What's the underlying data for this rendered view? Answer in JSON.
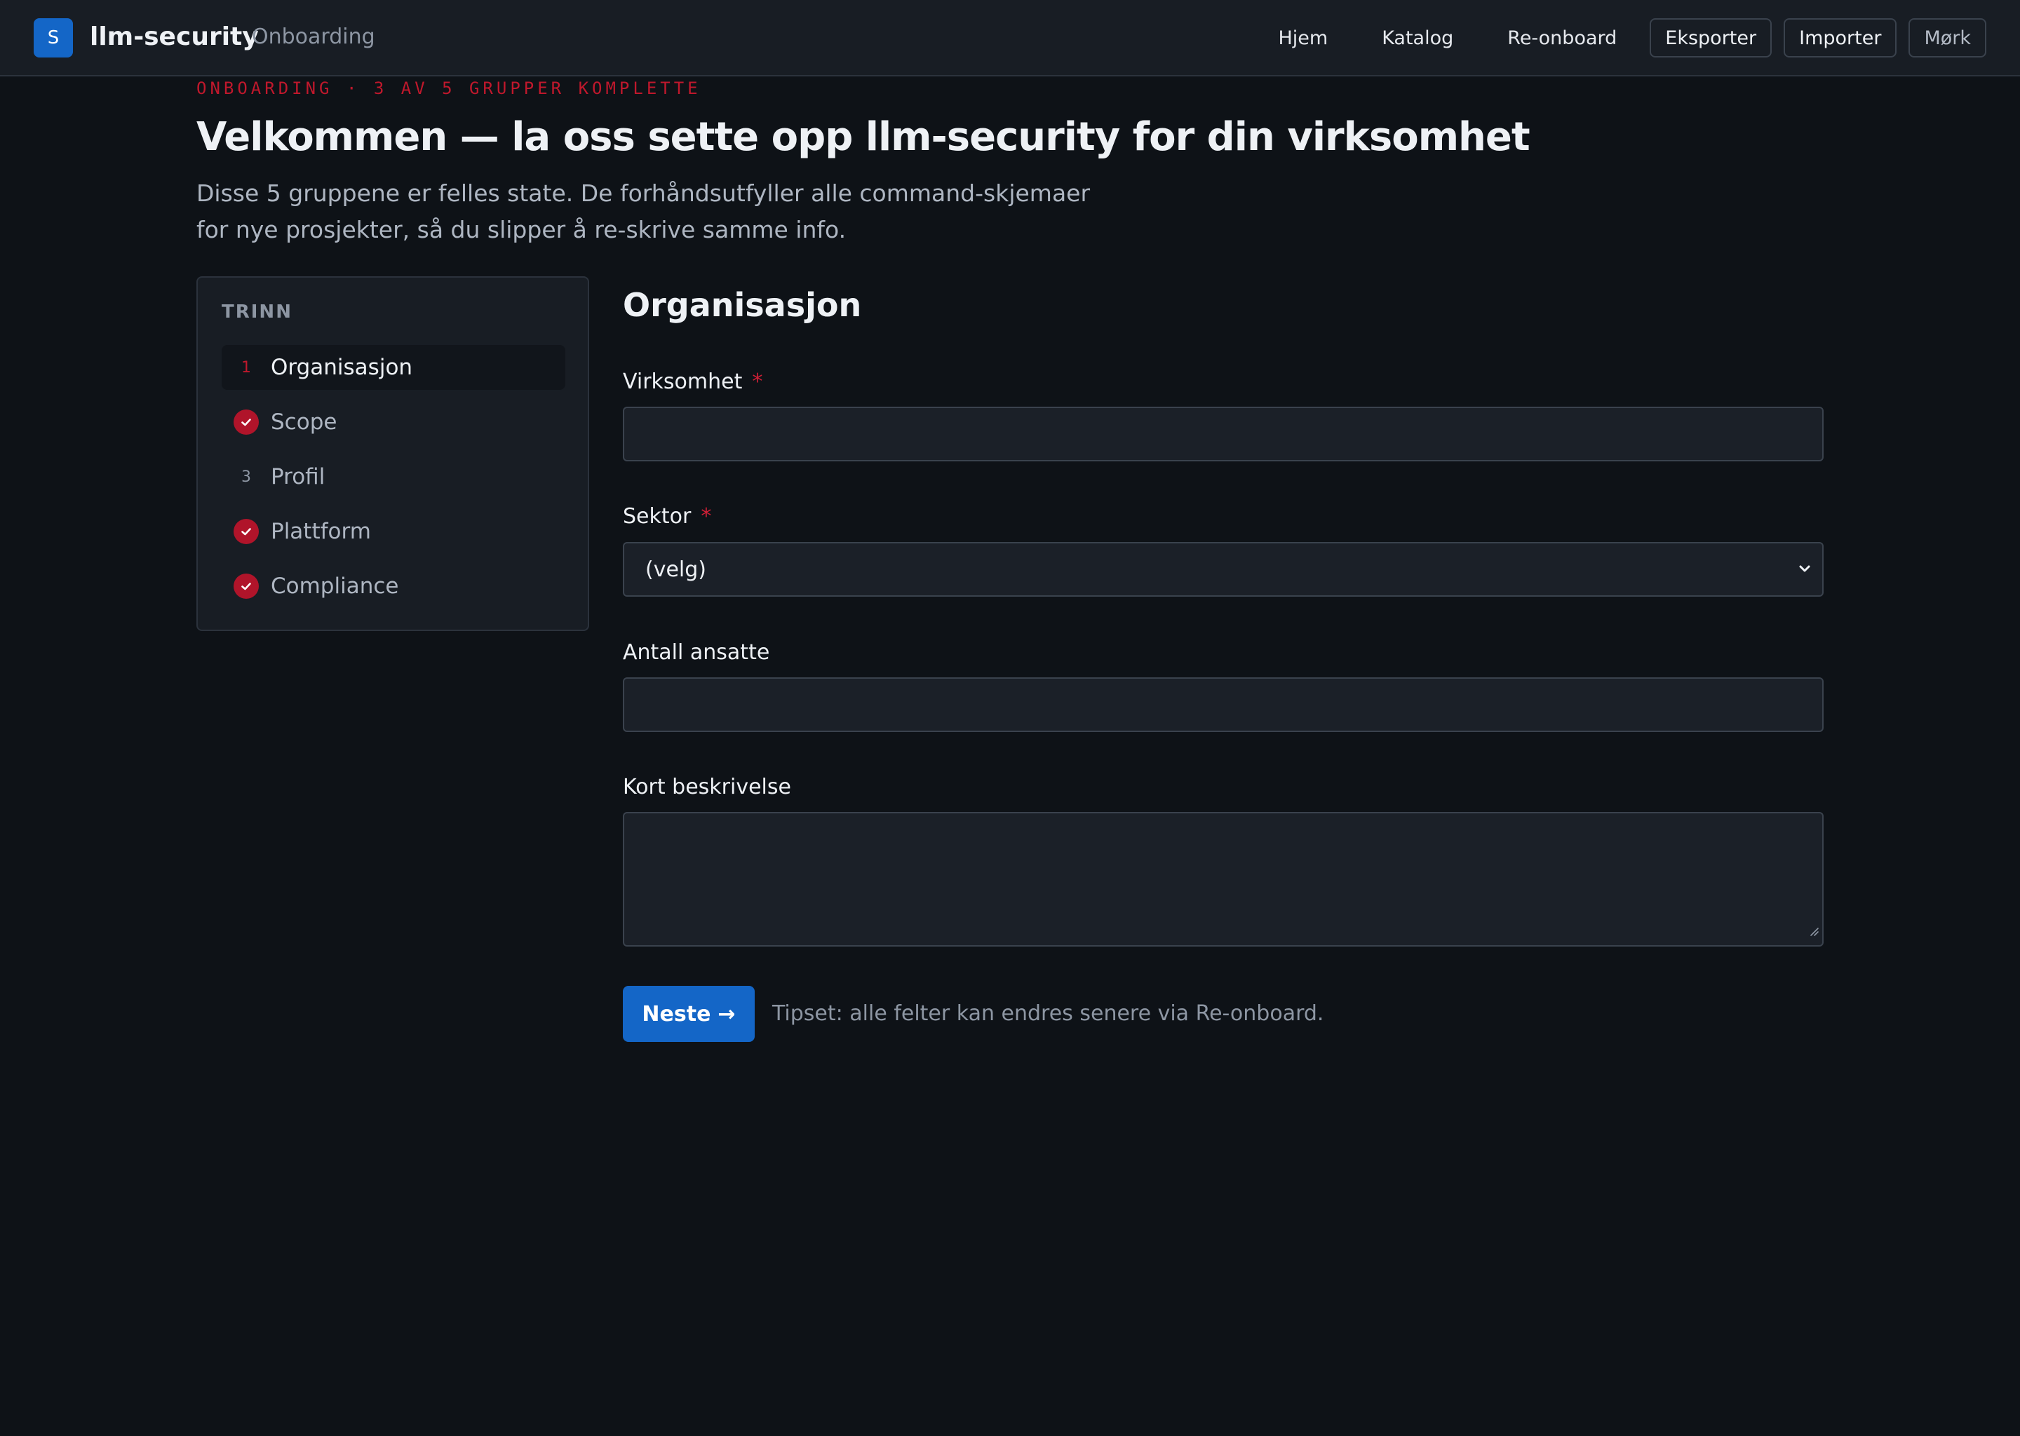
{
  "app": {
    "logo_letter": "S",
    "name": "llm-security",
    "section": "Onboarding"
  },
  "nav": {
    "links": [
      "Hjem",
      "Katalog",
      "Re-onboard"
    ],
    "buttons": [
      "Eksporter",
      "Importer",
      "Mørk"
    ]
  },
  "header": {
    "eyebrow": "ONBOARDING · 3 AV 5 GRUPPER KOMPLETTE",
    "title": "Velkommen — la oss sette opp llm-security for din virksomhet",
    "intro_line1": "Disse 5 gruppene er felles state. De forhåndsutfyller alle command-skjemaer",
    "intro_line2": "for nye prosjekter, så du slipper å re-skrive samme info."
  },
  "stepper": {
    "heading": "TRINN",
    "steps": [
      {
        "marker": "1",
        "label": "Organisasjon",
        "state": "active",
        "icon": "step-number"
      },
      {
        "marker": "",
        "label": "Scope",
        "state": "complete",
        "icon": "check-icon"
      },
      {
        "marker": "3",
        "label": "Profil",
        "state": "pending",
        "icon": "step-number"
      },
      {
        "marker": "",
        "label": "Plattform",
        "state": "complete",
        "icon": "check-icon"
      },
      {
        "marker": "",
        "label": "Compliance",
        "state": "complete",
        "icon": "check-icon"
      }
    ]
  },
  "form": {
    "title": "Organisasjon",
    "fields": {
      "virksomhet": {
        "label": "Virksomhet",
        "required_mark": "*",
        "value": ""
      },
      "sektor": {
        "label": "Sektor",
        "required_mark": "*",
        "value": "(velg)"
      },
      "ansatte": {
        "label": "Antall ansatte",
        "value": ""
      },
      "beskrivelse": {
        "label": "Kort beskrivelse",
        "value": ""
      }
    },
    "next_label": "Neste",
    "next_arrow": "→",
    "hint": "Tipset: alle felter kan endres senere via Re-onboard."
  },
  "colors": {
    "background": "#0e1217",
    "surface": "#181d24",
    "accent": "#1466c7",
    "danger": "#c0182c",
    "check": "#b0142a"
  }
}
